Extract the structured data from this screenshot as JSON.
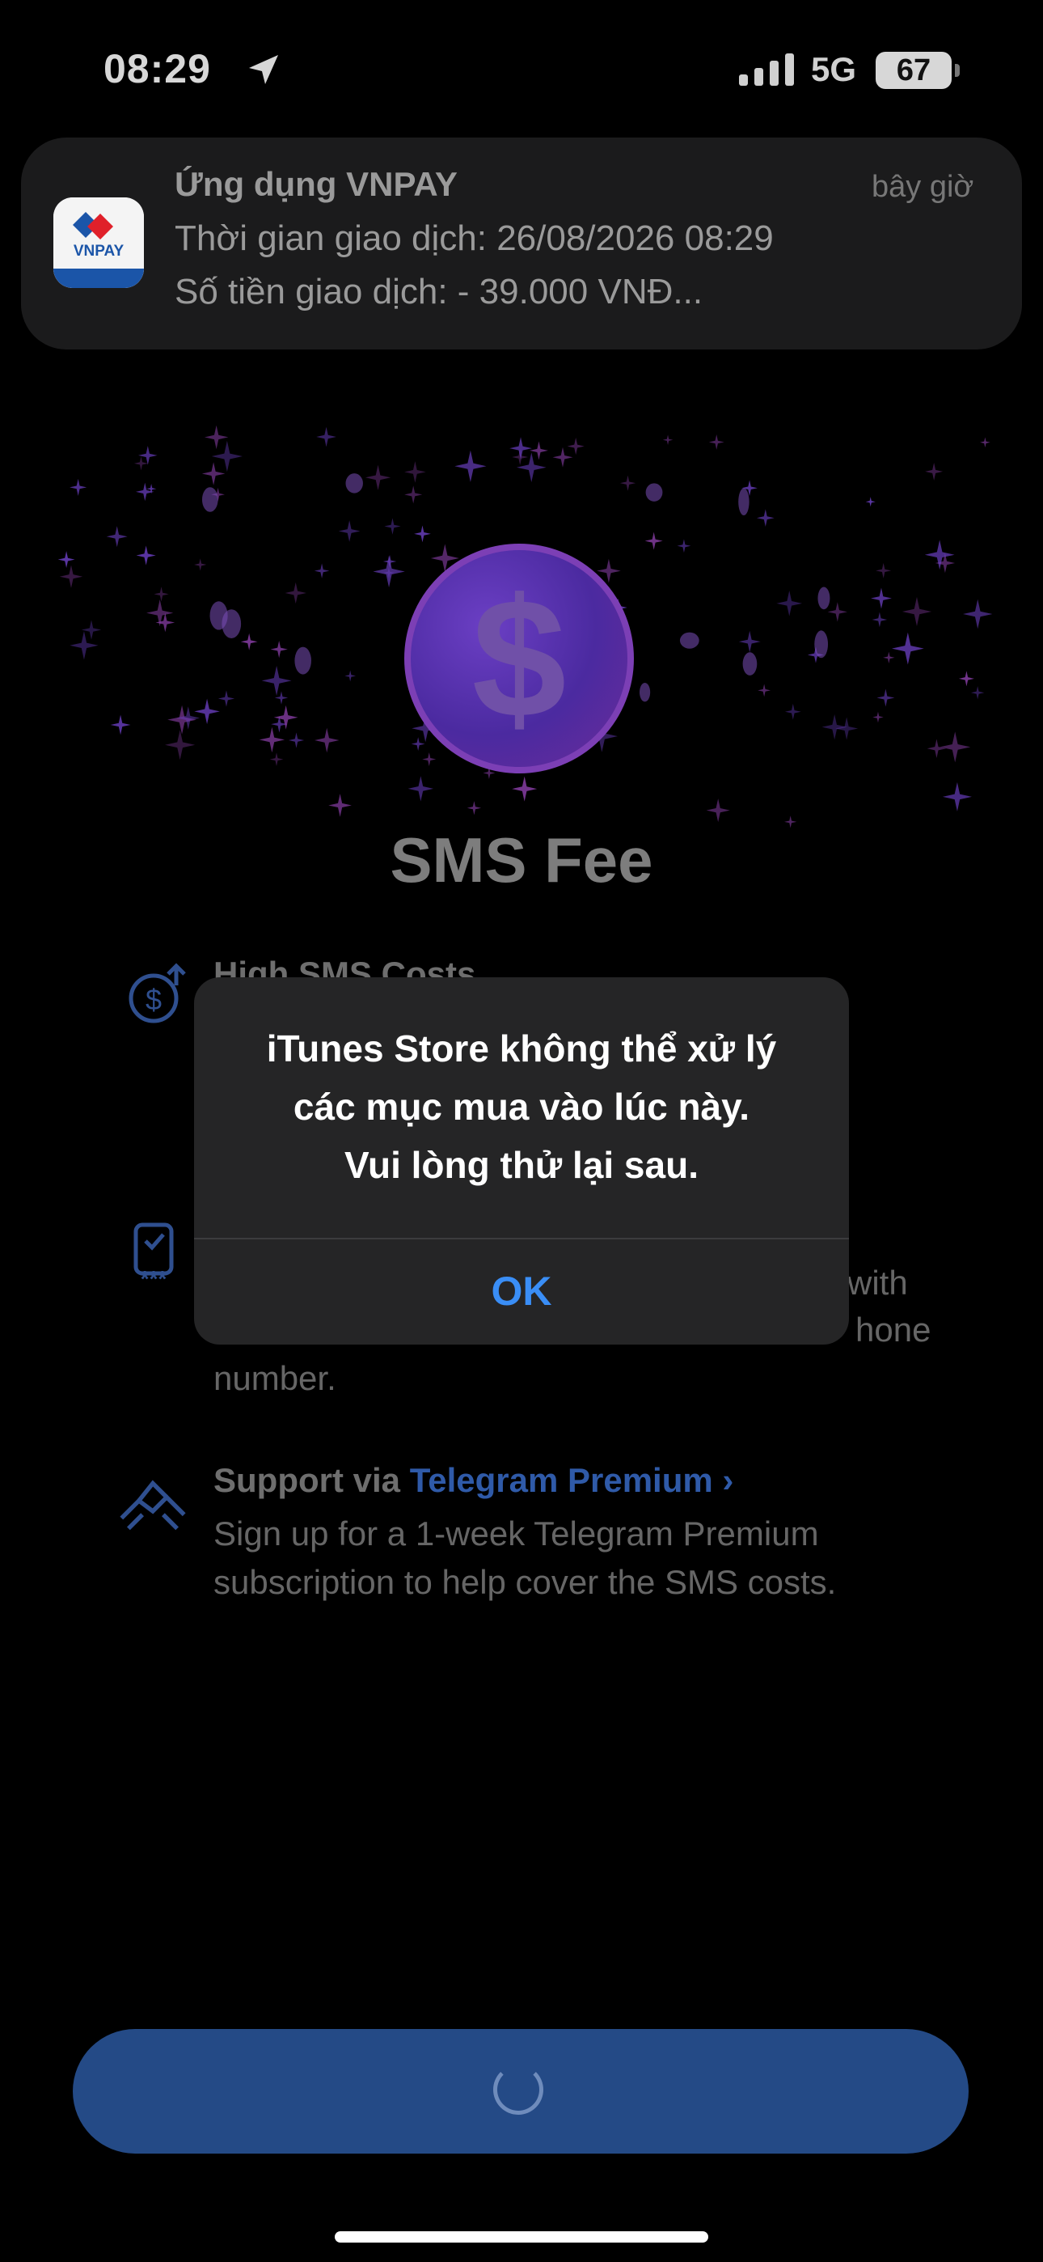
{
  "status_bar": {
    "time": "08:29",
    "network": "5G",
    "battery": "67"
  },
  "notification": {
    "app_name": "Ứng dụng VNPAY",
    "time": "bây giờ",
    "line1": "Thời gian giao dịch: 26/08/2026 08:29",
    "line2": "Số tiền giao dịch: - 39.000 VNĐ...",
    "icon_text": "VNPAY"
  },
  "page": {
    "title": "SMS Fee"
  },
  "features": [
    {
      "heading": "High SMS Costs",
      "icon": "dollar-up-icon"
    },
    {
      "desc_tail_1": "with",
      "desc_tail_2": "hone",
      "desc_line3": "number.",
      "icon": "phone-code-icon"
    },
    {
      "heading_prefix": "Support via ",
      "heading_link": "Telegram Premium",
      "chevron": "›",
      "desc_line1": "Sign up for a 1-week Telegram Premium",
      "desc_line2": "subscription to help cover the SMS costs.",
      "icon": "handshake-icon"
    }
  ],
  "alert": {
    "line1": "iTunes Store không thể xử lý",
    "line2": "các mục mua vào lúc này.",
    "line3": "Vui lòng thử lại sau.",
    "ok_label": "OK"
  },
  "colors": {
    "accent": "#3a8ef6",
    "button": "#244a86",
    "link": "#2f5aa8"
  }
}
